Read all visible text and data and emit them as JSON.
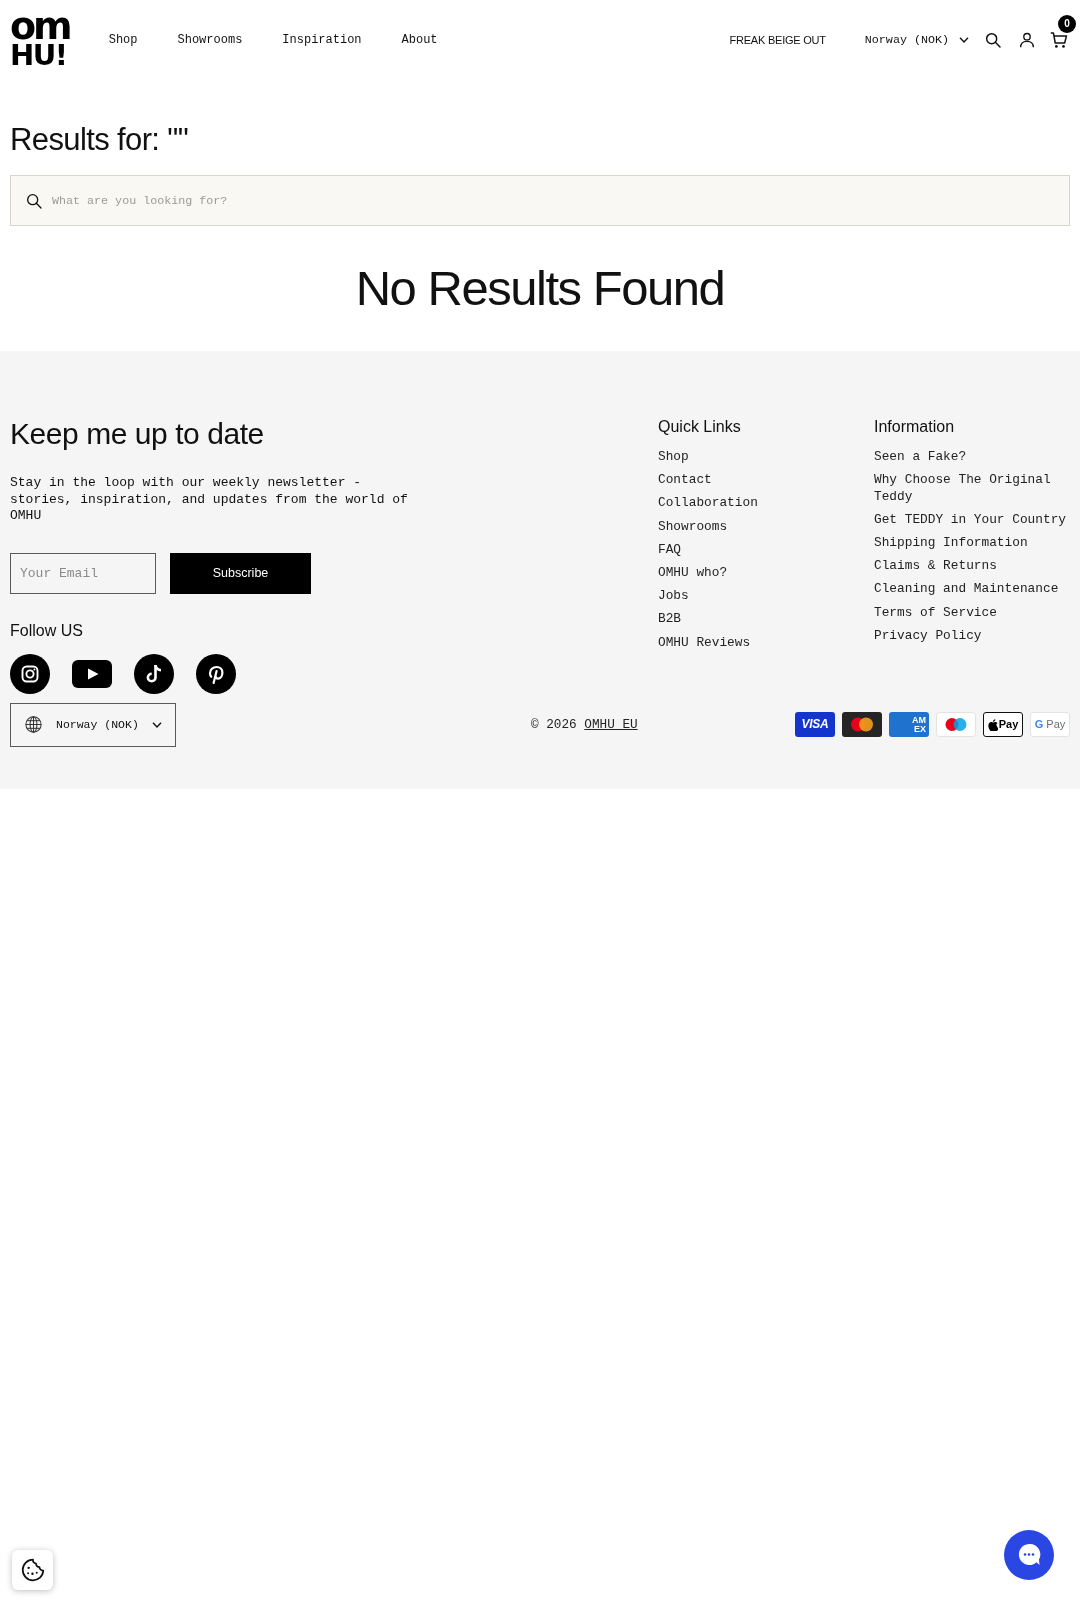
{
  "header": {
    "logo": [
      "om",
      "HU!"
    ],
    "nav": [
      "Shop",
      "Showrooms",
      "Inspiration",
      "About"
    ],
    "promo": "FREAK BEIGE OUT",
    "country": "Norway (NOK)",
    "cart_count": "0"
  },
  "search": {
    "heading": "Results for: \"\"",
    "placeholder": "What are you looking for?",
    "message": "No Results Found"
  },
  "footer": {
    "newsletter": {
      "title": "Keep me up to date",
      "text": "Stay in the loop with our weekly newsletter - stories, inspiration, and updates from the world of OMHU",
      "email_placeholder": "Your Email",
      "button": "Subscribe"
    },
    "columns": [
      {
        "title": "Quick Links",
        "links": [
          "Shop",
          "Contact",
          "Collaboration",
          "Showrooms",
          "FAQ",
          "OMHU who?",
          "Jobs",
          "B2B",
          "OMHU Reviews"
        ]
      },
      {
        "title": "Information",
        "links": [
          "Seen a Fake?",
          "Why Choose The Original Teddy",
          "Get TEDDY in Your Country",
          "Shipping Information",
          "Claims & Returns",
          "Cleaning and Maintenance",
          "Terms of Service",
          "Privacy Policy"
        ]
      }
    ],
    "follow_title": "Follow US",
    "social": [
      {
        "kind": "instagram"
      },
      {
        "kind": "youtube"
      },
      {
        "kind": "tiktok"
      },
      {
        "kind": "pinterest"
      }
    ],
    "country": "Norway (NOK)",
    "copyright": {
      "text": "© 2026",
      "link": "OMHU EU"
    },
    "payments": [
      {
        "kind": "visa",
        "label": "VISA"
      },
      {
        "kind": "mastercard"
      },
      {
        "kind": "amex",
        "label": "AM EX"
      },
      {
        "kind": "maestro"
      },
      {
        "kind": "applepay",
        "label": "Pay"
      },
      {
        "kind": "googlepay",
        "label": "G Pay"
      }
    ]
  }
}
